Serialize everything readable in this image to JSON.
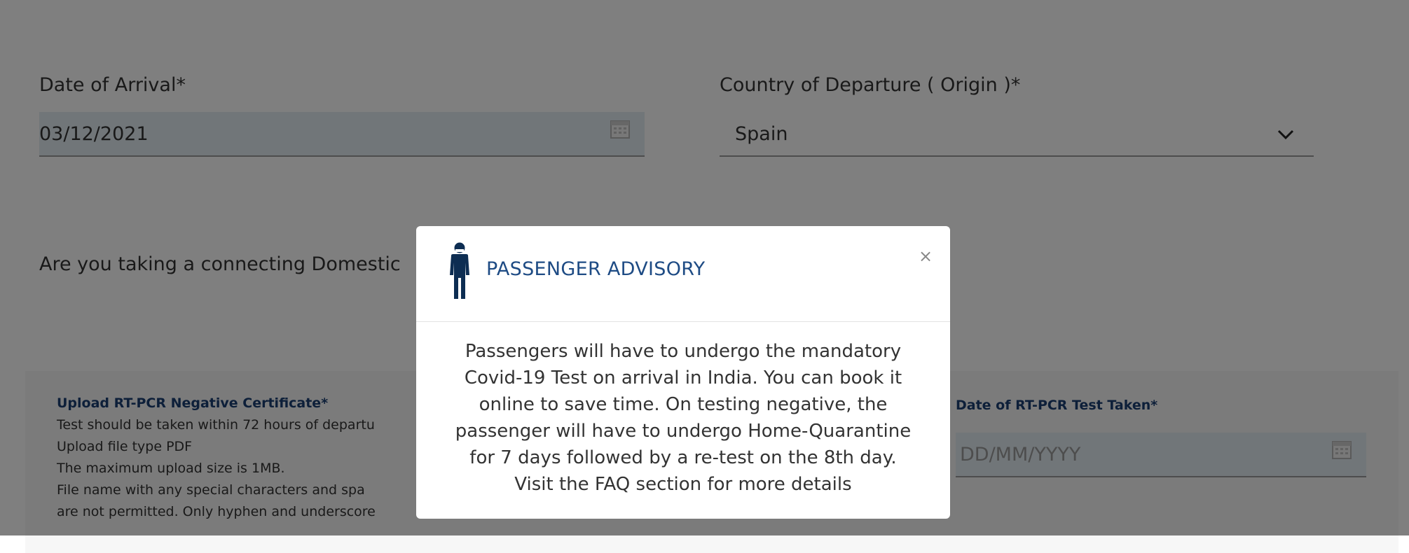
{
  "form": {
    "date_of_arrival": {
      "label": "Date of Arrival*",
      "value": "03/12/2021"
    },
    "country_of_departure": {
      "label": "Country of Departure ( Origin )*",
      "value": "Spain"
    },
    "connecting_question": "Are you taking a connecting Domestic",
    "upload": {
      "title": "Upload RT-PCR Negative Certificate*",
      "lines": [
        "Test should be taken within 72 hours of departu",
        "Upload file type PDF",
        "The maximum upload size is 1MB.",
        "File name with any special characters and spa",
        "are not permitted. Only hyphen and underscore"
      ]
    },
    "test_date": {
      "label": "Date of RT-PCR Test Taken*",
      "placeholder": "DD/MM/YYYY"
    }
  },
  "modal": {
    "title": "PASSENGER ADVISORY",
    "close_label": "×",
    "body_lines": [
      "Passengers will have to undergo the mandatory",
      "Covid-19 Test on arrival in India. You can book it",
      "online to save time. On testing negative, the",
      "passenger will have to undergo Home-Quarantine",
      "for 7 days followed by a re-test on the 8th day.",
      "Visit the FAQ section for more details"
    ]
  },
  "colors": {
    "accent": "#1e4b84",
    "field_background": "#e2ecf2",
    "overlay": "rgba(0,0,0,0.5)"
  }
}
